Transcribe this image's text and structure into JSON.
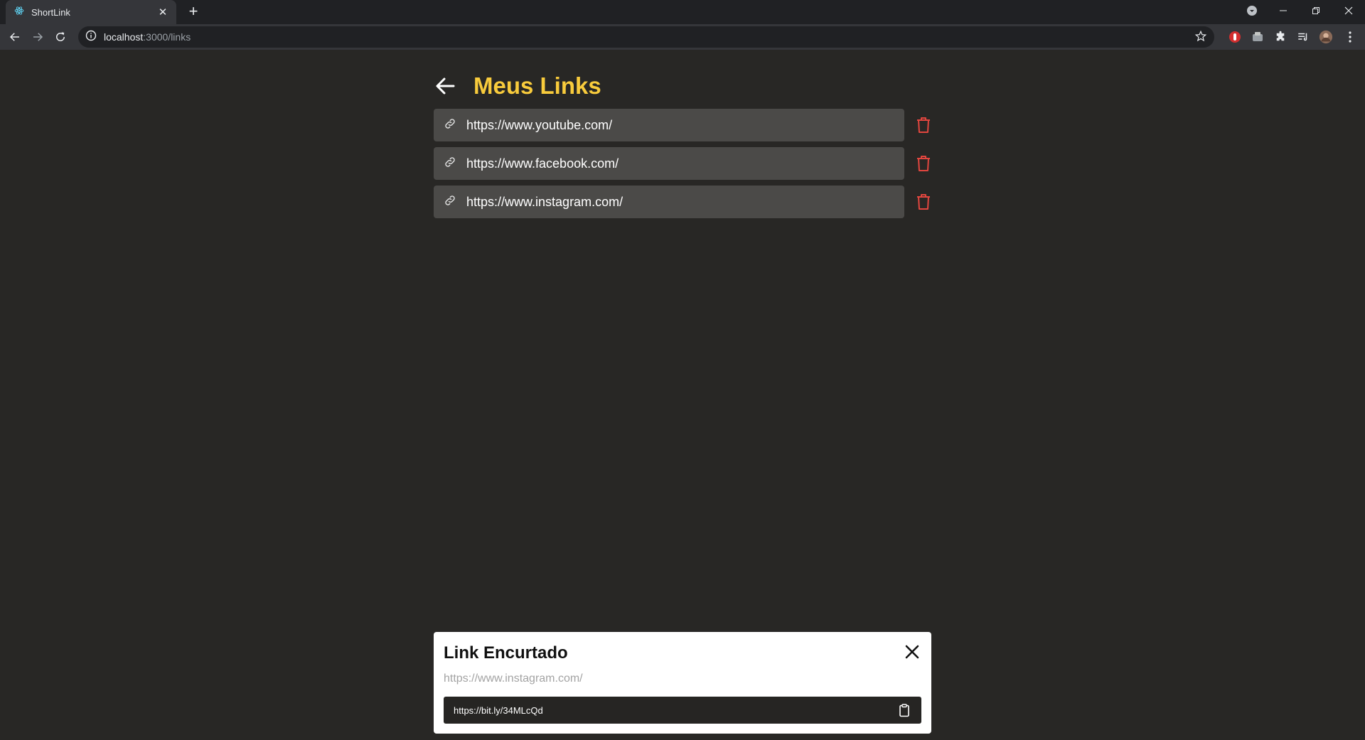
{
  "browser": {
    "tab_title": "ShortLink",
    "tab_close": "✕",
    "new_tab": "+",
    "url_host": "localhost",
    "url_path": ":3000/links"
  },
  "page": {
    "title": "Meus Links",
    "links": [
      {
        "url": "https://www.youtube.com/"
      },
      {
        "url": "https://www.facebook.com/"
      },
      {
        "url": "https://www.instagram.com/"
      }
    ]
  },
  "modal": {
    "title": "Link Encurtado",
    "original_url": "https://www.instagram.com/",
    "short_url": "https://bit.ly/34MLcQd"
  },
  "colors": {
    "accent": "#f8cb3c",
    "delete": "#e2463f",
    "background": "#282725",
    "link_box": "#4b4a48"
  }
}
